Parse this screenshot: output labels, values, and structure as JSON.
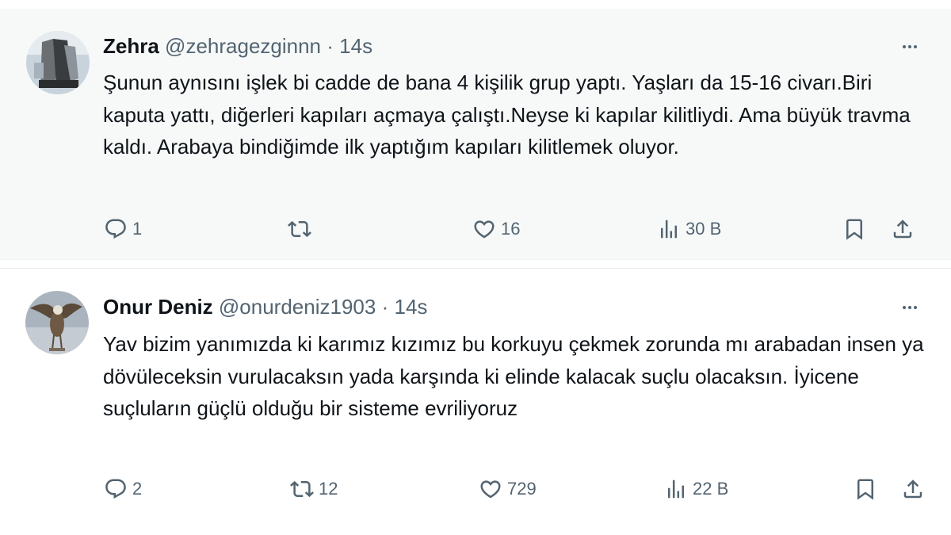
{
  "tweets": [
    {
      "author": {
        "name": "Zehra",
        "handle": "@zehragezginnn",
        "time": "14s"
      },
      "avatar_icon": "user-avatar-photo",
      "text": "Şunun aynısını işlek bi cadde de bana 4 kişilik grup yaptı. Yaşları da 15-16 civarı.Biri kaputa yattı, diğerleri kapıları açmaya çalıştı.Neyse ki kapılar kilitliydi. Ama büyük travma kaldı. Arabaya bindiğimde ilk yaptığım kapıları kilitlemek oluyor.",
      "actions": {
        "replies": "1",
        "reposts": "",
        "likes": "16",
        "views": "30 B"
      }
    },
    {
      "author": {
        "name": "Onur Deniz",
        "handle": "@onurdeniz1903",
        "time": "14s"
      },
      "avatar_icon": "eagle-avatar-photo",
      "text": "Yav bizim yanımızda ki karımız kızımız bu korkuyu çekmek zorunda mı arabadan insen ya dövüleceksin vurulacaksın yada karşında ki elinde kalacak suçlu olacaksın. İyicene suçluların güçlü olduğu bir sisteme evriliyoruz",
      "actions": {
        "replies": "2",
        "reposts": "12",
        "likes": "729",
        "views": "22 B"
      }
    }
  ],
  "separator": "·",
  "colors": {
    "text": "#0f1419",
    "secondary": "#536471",
    "highlight_bg": "#f7f9f9"
  }
}
